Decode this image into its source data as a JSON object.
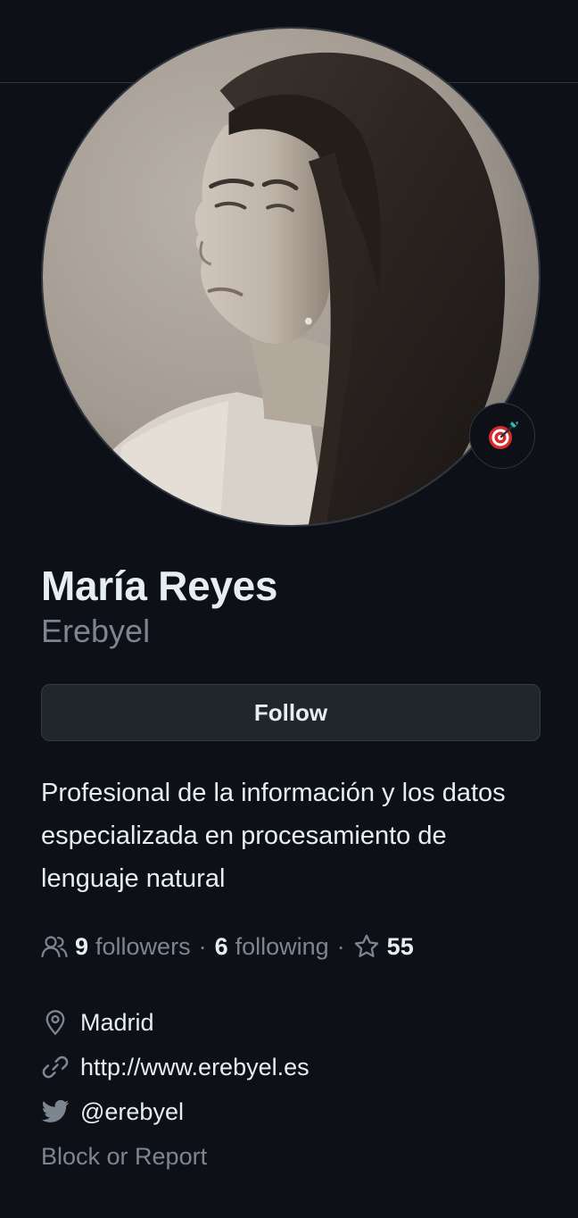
{
  "profile": {
    "full_name": "María Reyes",
    "username": "Erebyel",
    "avatar": "profile-photo",
    "status_emoji": "dart-bullseye-icon"
  },
  "actions": {
    "follow_label": "Follow",
    "block_report_label": "Block or Report"
  },
  "bio": "Profesional de la información y los datos especializada en procesamiento de lenguaje natural",
  "stats": {
    "followers_count": "9",
    "followers_label": "followers",
    "following_count": "6",
    "following_label": "following",
    "separator": "·",
    "stars_count": "55"
  },
  "details": {
    "location": "Madrid",
    "website": "http://www.erebyel.es",
    "twitter": "@erebyel"
  },
  "colors": {
    "background": "#0d1117",
    "text_primary": "#e6edf3",
    "text_muted": "#7d8590",
    "button_bg": "#21262d",
    "border": "#30363d"
  }
}
